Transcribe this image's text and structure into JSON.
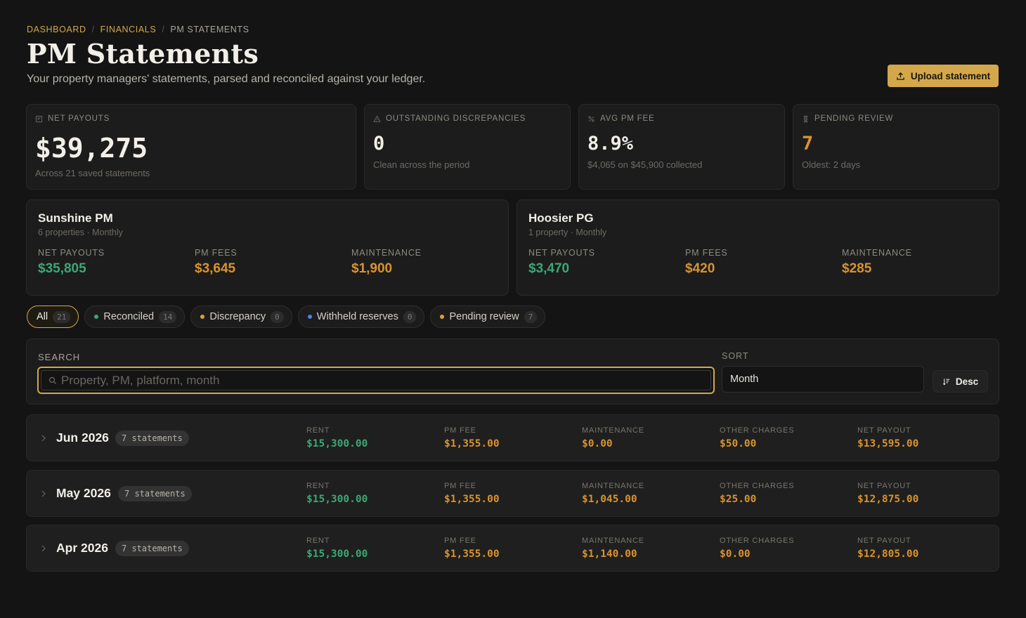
{
  "breadcrumb": {
    "items": [
      "DASHBOARD",
      "FINANCIALS",
      "PM STATEMENTS"
    ],
    "separator": "/"
  },
  "header": {
    "title": "PM Statements",
    "subtitle": "Your property managers' statements, parsed and reconciled against your ledger.",
    "upload_label": "Upload statement"
  },
  "kpis": [
    {
      "label": "NET PAYOUTS",
      "value": "$39,275",
      "note": "Across 21 saved statements",
      "icon": "receipt-icon"
    },
    {
      "label": "OUTSTANDING DISCREPANCIES",
      "value": "0",
      "note": "Clean across the period",
      "icon": "warning-icon"
    },
    {
      "label": "AVG PM FEE",
      "value": "8.9%",
      "note": "$4,065 on $45,900 collected",
      "icon": "percent-icon"
    },
    {
      "label": "PENDING REVIEW",
      "value": "7",
      "note": "Oldest: 2 days",
      "icon": "hourglass-icon"
    }
  ],
  "managers": [
    {
      "name": "Sunshine PM",
      "meta": "6 properties · Monthly",
      "metrics": [
        {
          "label": "NET PAYOUTS",
          "value": "$35,805"
        },
        {
          "label": "PM FEES",
          "value": "$3,645"
        },
        {
          "label": "MAINTENANCE",
          "value": "$1,900"
        }
      ]
    },
    {
      "name": "Hoosier PG",
      "meta": "1 property · Monthly",
      "metrics": [
        {
          "label": "NET PAYOUTS",
          "value": "$3,470"
        },
        {
          "label": "PM FEES",
          "value": "$420"
        },
        {
          "label": "MAINTENANCE",
          "value": "$285"
        }
      ]
    }
  ],
  "filters": [
    {
      "label": "All",
      "count": "21"
    },
    {
      "label": "Reconciled",
      "count": "14",
      "color": "#3aa876"
    },
    {
      "label": "Discrepancy",
      "count": "0",
      "color": "#e0a030"
    },
    {
      "label": "Withheld reserves",
      "count": "0",
      "color": "#4f7fe0"
    },
    {
      "label": "Pending review",
      "count": "7",
      "color": "#e0a030"
    }
  ],
  "search": {
    "label": "SEARCH",
    "placeholder": "Property, PM, platform, month",
    "value": ""
  },
  "sort": {
    "label": "SORT",
    "selected": "Month",
    "direction_label": "Desc"
  },
  "columns": [
    "RENT",
    "PM FEE",
    "MAINTENANCE",
    "OTHER CHARGES",
    "NET PAYOUT"
  ],
  "months": [
    {
      "name": "Jun 2026",
      "badge": "7 statements",
      "values": [
        "$15,300.00",
        "$1,355.00",
        "$0.00",
        "$50.00",
        "$13,595.00"
      ]
    },
    {
      "name": "May 2026",
      "badge": "7 statements",
      "values": [
        "$15,300.00",
        "$1,355.00",
        "$1,045.00",
        "$25.00",
        "$12,875.00"
      ]
    },
    {
      "name": "Apr 2026",
      "badge": "7 statements",
      "values": [
        "$15,300.00",
        "$1,355.00",
        "$1,140.00",
        "$0.00",
        "$12,805.00"
      ]
    }
  ]
}
